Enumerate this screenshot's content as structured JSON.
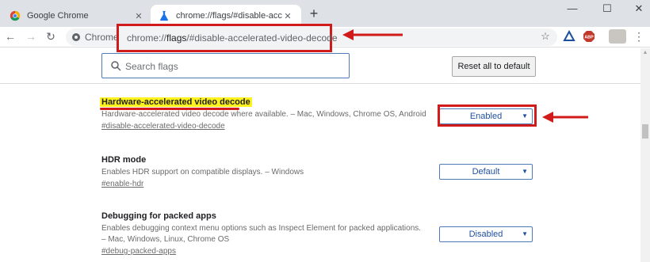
{
  "tabs": [
    {
      "title": "Google Chrome",
      "active": false
    },
    {
      "title": "chrome://flags/#disable-accelerated-video-decode",
      "active": true
    }
  ],
  "window_controls": {
    "minimize": "—",
    "maximize": "☐",
    "close": "✕"
  },
  "toolbar": {
    "omnibox_prefix": "Chrome",
    "url_host": "chrome://",
    "url_path_bold": "flags",
    "url_rest": "/#disable-accelerated-video-decode",
    "extension_badge": "ABP"
  },
  "header": {
    "search_placeholder": "Search flags",
    "reset_button": "Reset all to default"
  },
  "experiments": [
    {
      "title": "Hardware-accelerated video decode",
      "description": "Hardware-accelerated video decode where available. – Mac, Windows, Chrome OS, Android",
      "link": "#disable-accelerated-video-decode",
      "value": "Enabled"
    },
    {
      "title": "HDR mode",
      "description": "Enables HDR support on compatible displays. – Windows",
      "link": "#enable-hdr",
      "value": "Default"
    },
    {
      "title": "Debugging for packed apps",
      "description_line1": "Enables debugging context menu options such as Inspect Element for packed applications.",
      "description_line2": "– Mac, Windows, Linux, Chrome OS",
      "link": "#debug-packed-apps",
      "value": "Disabled"
    }
  ],
  "colors": {
    "annotation_red": "#d11a1a",
    "highlight_yellow": "#fff21d",
    "select_blue": "#1f4f9e",
    "tabstrip_gray": "#dee1e6"
  }
}
